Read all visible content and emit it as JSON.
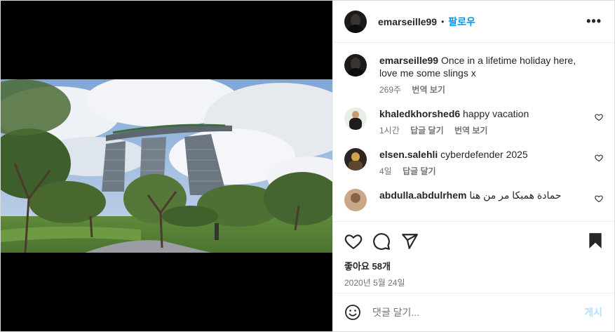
{
  "post": {
    "author": "emarseille99",
    "follow_label": "팔로우",
    "separator": "•",
    "more_label": "•••"
  },
  "caption": {
    "user": "emarseille99",
    "text": "Once in a lifetime holiday here, love me some slings x",
    "time": "269주",
    "translate_label": "번역 보기"
  },
  "comments": [
    {
      "user": "khaledkhorshed6",
      "text": "happy vacation",
      "time": "1시간",
      "reply_label": "답글 달기",
      "translate_label": "번역 보기"
    },
    {
      "user": "elsen.salehli",
      "text": "cyberdefender 2025",
      "time": "4일",
      "reply_label": "답글 달기"
    },
    {
      "user": "abdulla.abdulrhem",
      "text": "حمادة همبكا مر من هنا"
    }
  ],
  "likes": {
    "label": "좋아요 58개"
  },
  "date": "2020년 5월 24일",
  "add_comment": {
    "placeholder": "댓글 달기...",
    "post_label": "게시"
  },
  "colors": {
    "link": "#0095f6",
    "post_disabled": "#b2dffc",
    "muted": "#737373"
  },
  "icons": [
    "heart-icon",
    "comment-icon",
    "share-icon",
    "bookmark-icon",
    "emoji-icon",
    "more-icon"
  ]
}
